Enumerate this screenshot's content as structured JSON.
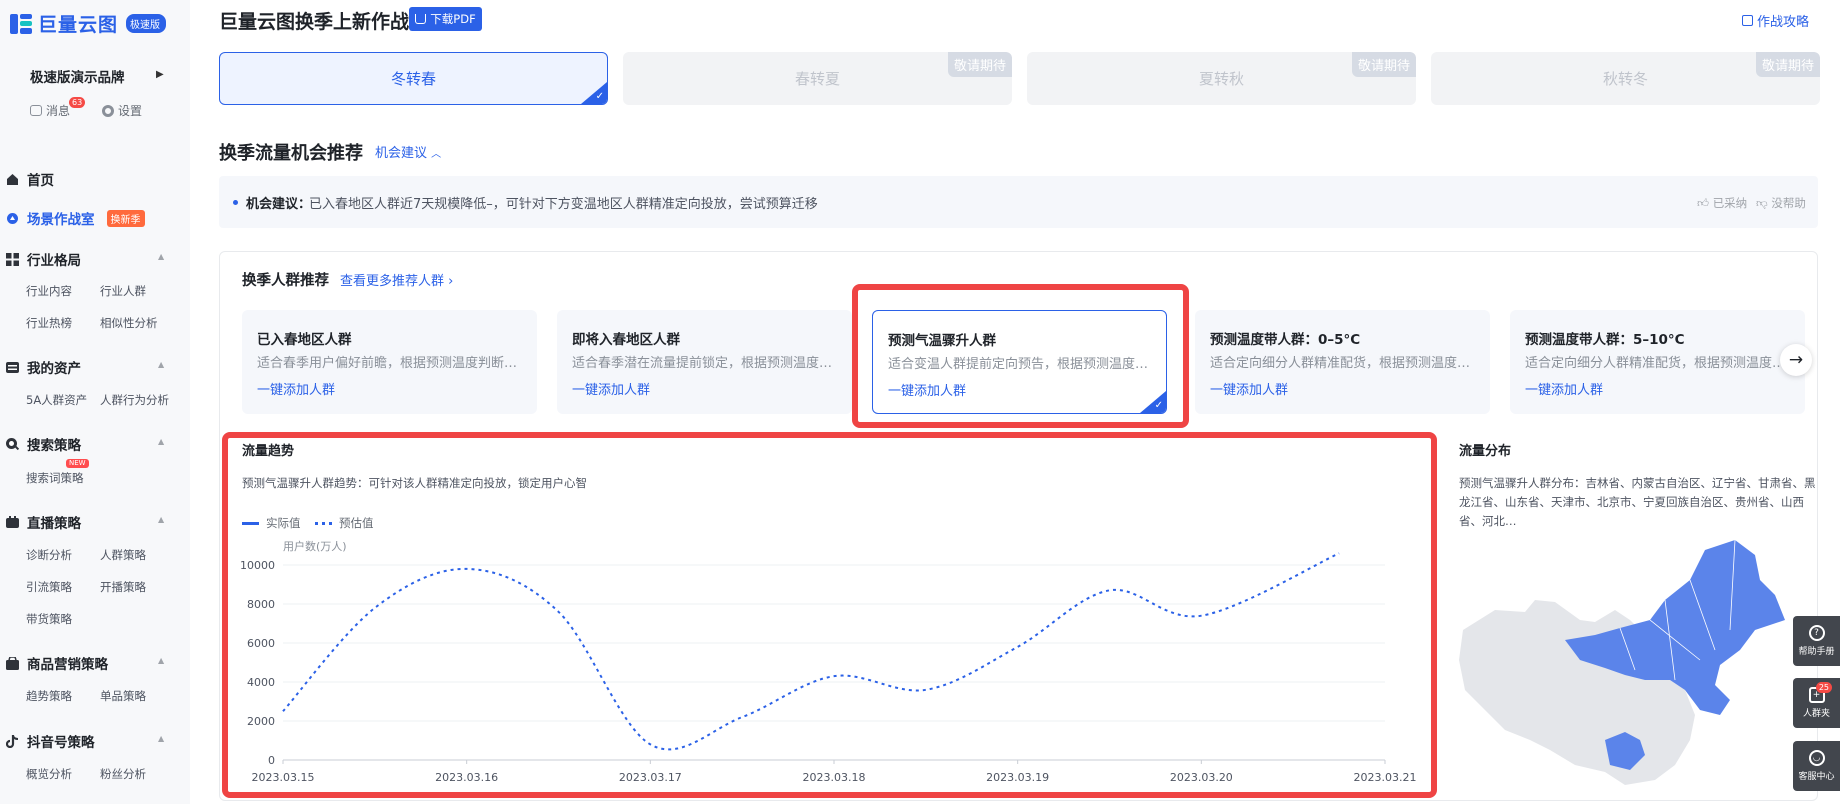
{
  "app": {
    "logo_text": "巨量云图",
    "logo_badge": "极速版"
  },
  "sidebar": {
    "brand": "极速版演示品牌",
    "messages_label": "消息",
    "messages_count": "63",
    "settings_label": "设置",
    "home": "首页",
    "scene": "场景作战室",
    "scene_tag": "换新季",
    "industry": {
      "label": "行业格局",
      "items": [
        "行业内容",
        "行业人群",
        "行业热榜",
        "相似性分析"
      ]
    },
    "assets": {
      "label": "我的资产",
      "items": [
        "5A人群资产",
        "人群行为分析"
      ]
    },
    "search": {
      "label": "搜索策略",
      "items": [
        "搜索词策略"
      ],
      "new_tag": "NEW"
    },
    "live": {
      "label": "直播策略",
      "items": [
        "诊断分析",
        "人群策略",
        "引流策略",
        "开播策略",
        "带货策略"
      ]
    },
    "goods": {
      "label": "商品营销策略",
      "items": [
        "趋势策略",
        "单品策略"
      ]
    },
    "douyin": {
      "label": "抖音号策略",
      "items": [
        "概览分析",
        "粉丝分析"
      ]
    }
  },
  "header": {
    "title": "巨量云图换季上新作战",
    "pdf_button": "下载PDF",
    "strategy_link": "作战攻略"
  },
  "seasons": [
    {
      "label": "冬转春",
      "active": true
    },
    {
      "label": "春转夏",
      "badge": "敬请期待"
    },
    {
      "label": "夏转秋",
      "badge": "敬请期待"
    },
    {
      "label": "秋转冬",
      "badge": "敬请期待"
    }
  ],
  "opportunity": {
    "title": "换季流量机会推荐",
    "link": "机会建议",
    "advice_label": "机会建议：",
    "advice_text": "已入春地区人群近7天规模降低–，可针对下方变温地区人群精准定向投放，尝试预算迁移",
    "adopted": "已采纳",
    "unhelpful": "没帮助"
  },
  "crowd": {
    "title": "换季人群推荐",
    "more_link": "查看更多推荐人群",
    "add_label": "一键添加人群",
    "cards": [
      {
        "title": "已入春地区人群",
        "desc": "适合春季用户偏好前瞻，根据预测温度判断…"
      },
      {
        "title": "即将入春地区人群",
        "desc": "适合春季潜在流量提前锁定，根据预测温度…"
      },
      {
        "title": "预测气温骤升人群",
        "desc": "适合变温人群提前定向预告，根据预测温度…",
        "active": true
      },
      {
        "title": "预测温度带人群：0–5°C",
        "desc": "适合定向细分人群精准配货，根据预测温度…"
      },
      {
        "title": "预测温度带人群：5–10°C",
        "desc": "适合定向细分人群精准配货，根据预测温度…"
      }
    ]
  },
  "trend": {
    "title": "流量趋势",
    "subtitle": "预测气温骤升人群趋势：可针对该人群精准定向投放，锁定用户心智",
    "legend_actual": "实际值",
    "legend_forecast": "预估值"
  },
  "chart_data": {
    "type": "line",
    "ylabel": "用户数(万人)",
    "ylim": [
      0,
      10000
    ],
    "yticks": [
      0,
      2000,
      4000,
      6000,
      8000,
      10000
    ],
    "x": [
      "2023.03.15",
      "2023.03.16",
      "2023.03.17",
      "2023.03.18",
      "2023.03.19",
      "2023.03.20",
      "2023.03.21"
    ],
    "series": [
      {
        "name": "预估值",
        "style": "dotted",
        "points": [
          [
            "2023.03.15",
            2500
          ],
          [
            "2023.03.15 12:00",
            7800
          ],
          [
            "2023.03.16",
            9800
          ],
          [
            "2023.03.16 12:00",
            7600
          ],
          [
            "2023.03.17",
            800
          ],
          [
            "2023.03.17 12:00",
            2200
          ],
          [
            "2023.03.18",
            4300
          ],
          [
            "2023.03.18 12:00",
            3600
          ],
          [
            "2023.03.19",
            5800
          ],
          [
            "2023.03.19 12:00",
            8700
          ],
          [
            "2023.03.20",
            7400
          ],
          [
            "2023.03.20 18:00",
            10600
          ]
        ]
      }
    ],
    "color": "#2b61e7",
    "grid": true
  },
  "distribution": {
    "title": "流量分布",
    "text": "预测气温骤升人群分布：吉林省、内蒙古自治区、辽宁省、甘肃省、黑龙江省、山东省、天津市、北京市、宁夏回族自治区、贵州省、山西省、河北…"
  },
  "floating": {
    "help": "帮助手册",
    "folder": "人群夹",
    "folder_count": "25",
    "service": "客服中心"
  },
  "colors": {
    "accent": "#2b61e7",
    "highlight": "#ef4444",
    "map_fill": "#5b84ea",
    "map_base": "#e4e6ea"
  }
}
